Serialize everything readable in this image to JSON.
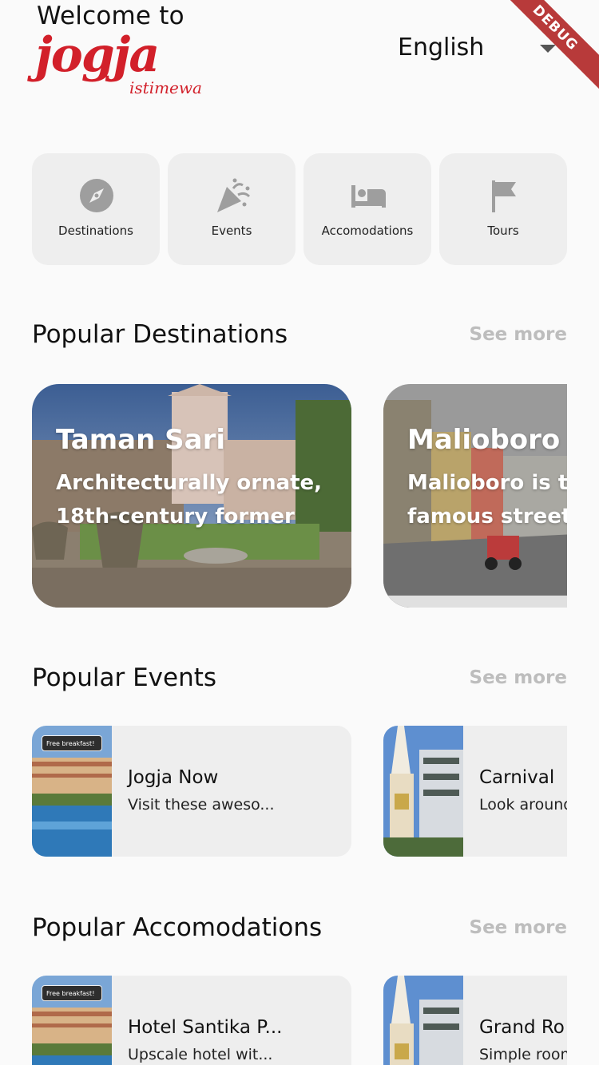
{
  "header": {
    "welcome": "Welcome to",
    "logo_main": "jogja",
    "logo_sub": "istimewa",
    "language": "English",
    "debug_banner": "DEBUG"
  },
  "categories": [
    {
      "label": "Destinations",
      "icon": "compass-icon"
    },
    {
      "label": "Events",
      "icon": "party-popper-icon"
    },
    {
      "label": "Accomodations",
      "icon": "bed-icon"
    },
    {
      "label": "Tours",
      "icon": "flag-icon"
    }
  ],
  "sections": {
    "destinations": {
      "title": "Popular Destinations",
      "see_more": "See more"
    },
    "events": {
      "title": "Popular Events",
      "see_more": "See more"
    },
    "accomodations": {
      "title": "Popular Accomodations",
      "see_more": "See more"
    }
  },
  "destinations": [
    {
      "title": "Taman Sari",
      "desc": "Architecturally ornate,\n18th-century former"
    },
    {
      "title": "Malioboro",
      "desc": "Malioboro is the\nfamous street"
    }
  ],
  "events": [
    {
      "title": "Jogja Now",
      "subtitle": "Visit these aweso...",
      "badge": "Free breakfast!"
    },
    {
      "title": "Carnival",
      "subtitle": "Look around"
    }
  ],
  "accomodations": [
    {
      "title": "Hotel Santika P...",
      "subtitle": "Upscale hotel wit...",
      "badge": "Free breakfast!"
    },
    {
      "title": "Grand Ro",
      "subtitle": "Simple room"
    }
  ],
  "colors": {
    "brand_red": "#d2202a",
    "card_bg": "#eeeeee",
    "muted_link": "#bdbdbd"
  }
}
